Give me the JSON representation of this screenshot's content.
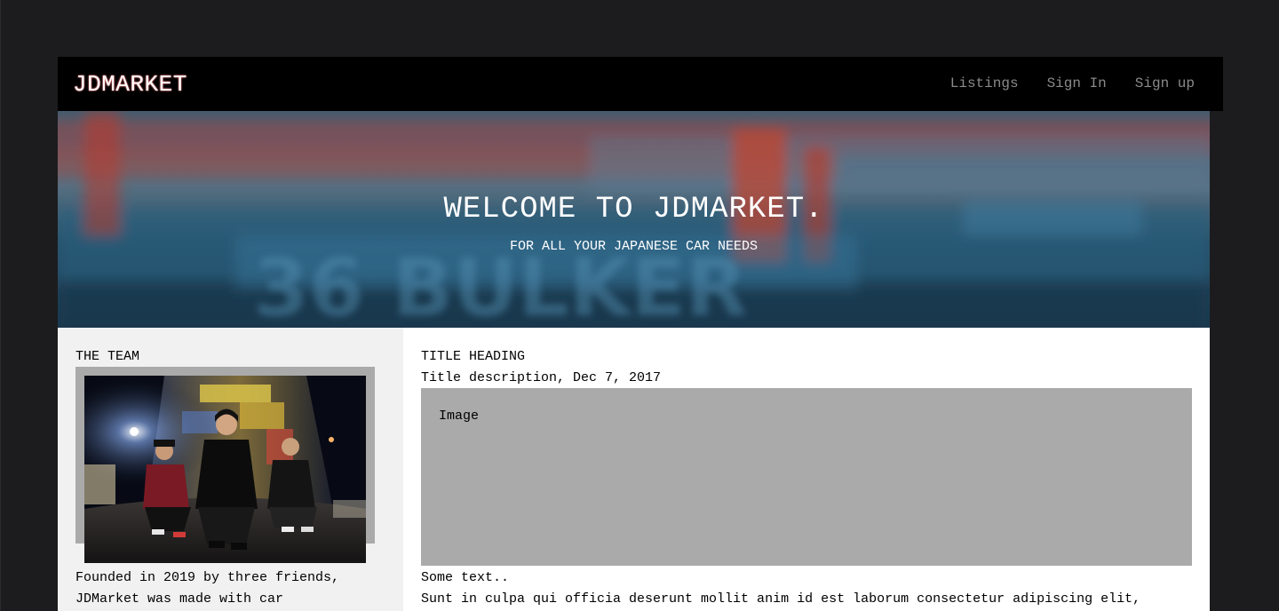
{
  "nav": {
    "brand": "JDMARKET",
    "links": [
      "Listings",
      "Sign In",
      "Sign up"
    ]
  },
  "hero": {
    "title": "WELCOME TO JDMARKET.",
    "subtitle": "FOR ALL YOUR JAPANESE CAR NEEDS"
  },
  "sidebar": {
    "heading": "THE TEAM",
    "text_line1": "Founded in 2019 by three friends,",
    "text_line2": "JDMarket was made with car"
  },
  "post": {
    "title": "TITLE HEADING",
    "description": "Title description, Dec 7, 2017",
    "image_label": "Image",
    "text_heading": "Some text..",
    "body": "Sunt in culpa qui officia deserunt mollit anim id est laborum consectetur adipiscing elit,"
  },
  "colors": {
    "page_bg": "#1c1c1e",
    "nav_bg": "#000000",
    "nav_link": "#8a8a8a",
    "sidebar_bg": "#f1f1f1",
    "placeholder": "#aaaaaa"
  }
}
